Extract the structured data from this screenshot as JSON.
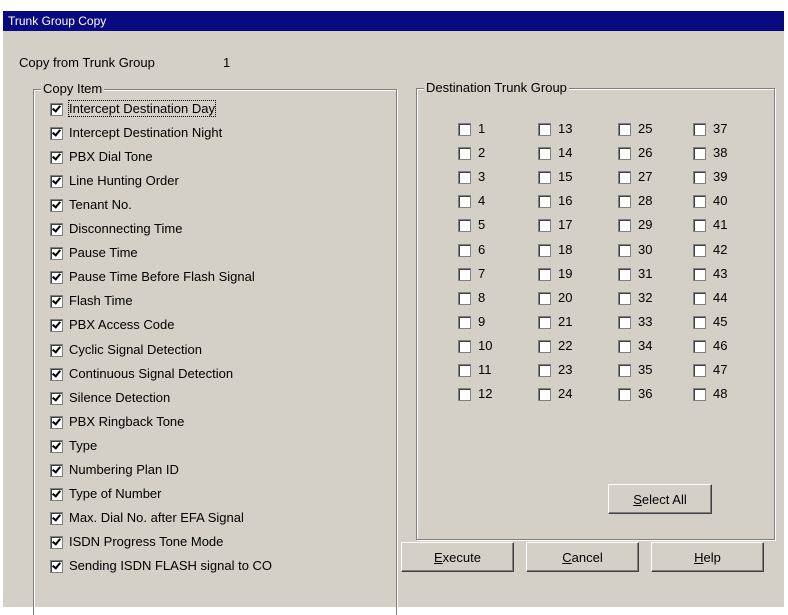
{
  "window": {
    "title": "Trunk Group Copy"
  },
  "copy_from": {
    "label": "Copy from Trunk Group",
    "value": "1"
  },
  "copy_item": {
    "legend": "Copy Item",
    "items": [
      {
        "label": "Intercept Destination Day",
        "checked": true
      },
      {
        "label": "Intercept Destination Night",
        "checked": true
      },
      {
        "label": "PBX Dial Tone",
        "checked": true
      },
      {
        "label": "Line Hunting Order",
        "checked": true
      },
      {
        "label": "Tenant No.",
        "checked": true
      },
      {
        "label": "Disconnecting Time",
        "checked": true
      },
      {
        "label": "Pause Time",
        "checked": true
      },
      {
        "label": "Pause Time Before Flash Signal",
        "checked": true
      },
      {
        "label": "Flash Time",
        "checked": true
      },
      {
        "label": "PBX Access Code",
        "checked": true
      },
      {
        "label": "Cyclic Signal Detection",
        "checked": true
      },
      {
        "label": "Continuous Signal Detection",
        "checked": true
      },
      {
        "label": "Silence Detection",
        "checked": true
      },
      {
        "label": "PBX Ringback Tone",
        "checked": true
      },
      {
        "label": "Type",
        "checked": true
      },
      {
        "label": "Numbering Plan ID",
        "checked": true
      },
      {
        "label": "Type of Number",
        "checked": true
      },
      {
        "label": "Max. Dial No. after EFA Signal",
        "checked": true
      },
      {
        "label": "ISDN Progress Tone Mode",
        "checked": true
      },
      {
        "label": "Sending ISDN FLASH signal to CO",
        "checked": true
      }
    ]
  },
  "destination": {
    "legend": "Destination Trunk Group",
    "groups": [
      "1",
      "2",
      "3",
      "4",
      "5",
      "6",
      "7",
      "8",
      "9",
      "10",
      "11",
      "12",
      "13",
      "14",
      "15",
      "16",
      "17",
      "18",
      "19",
      "20",
      "21",
      "22",
      "23",
      "24",
      "25",
      "26",
      "27",
      "28",
      "29",
      "30",
      "31",
      "32",
      "33",
      "34",
      "35",
      "36",
      "37",
      "38",
      "39",
      "40",
      "41",
      "42",
      "43",
      "44",
      "45",
      "46",
      "47",
      "48"
    ],
    "select_all": {
      "mnemonic": "S",
      "rest": "elect All"
    }
  },
  "buttons": {
    "execute": {
      "mnemonic": "E",
      "rest": "xecute"
    },
    "cancel": {
      "mnemonic": "C",
      "rest": "ancel"
    },
    "help": {
      "mnemonic": "H",
      "rest": "elp"
    }
  }
}
